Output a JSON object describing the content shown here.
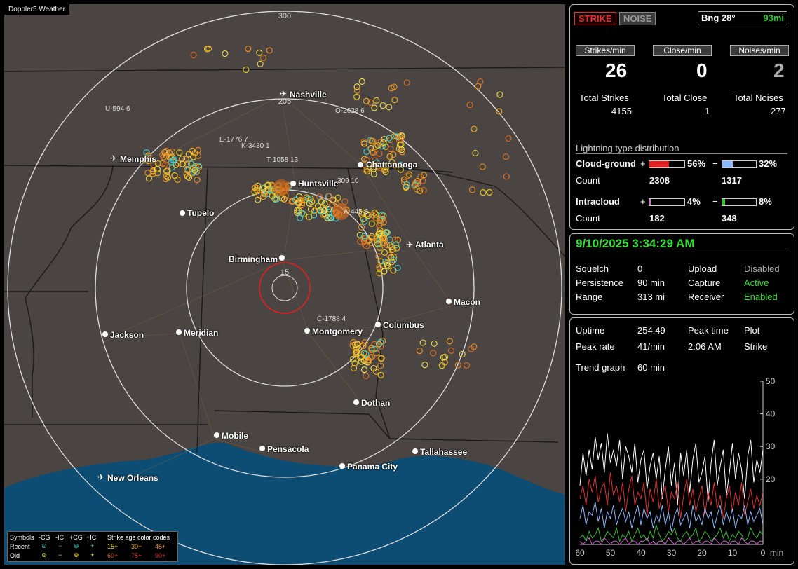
{
  "app": {
    "title": "Doppler5 Weather"
  },
  "header": {
    "strike_label": "STRIKE",
    "noise_label": "NOISE",
    "bearing": "Bng 28°",
    "distance": "93mi"
  },
  "rates": {
    "strikes_label": "Strikes/min",
    "close_label": "Close/min",
    "noises_label": "Noises/min",
    "strikes_value": "26",
    "close_value": "0",
    "noises_value": "2"
  },
  "totals": {
    "strikes_label": "Total Strikes",
    "close_label": "Total Close",
    "noises_label": "Total Noises",
    "strikes_value": "4155",
    "close_value": "1",
    "noises_value": "277"
  },
  "distribution": {
    "title": "Lightning type distribution",
    "cg_label": "Cloud-ground",
    "ic_label": "Intracloud",
    "count_label": "Count",
    "cg_pos_pct": "56%",
    "cg_neg_pct": "32%",
    "cg_pos_count": "2308",
    "cg_neg_count": "1317",
    "ic_pos_pct": "4%",
    "ic_neg_pct": "8%",
    "ic_pos_count": "182",
    "ic_neg_count": "348",
    "plus": "+",
    "minus": "−",
    "fractions": {
      "cg_pos": 0.56,
      "cg_neg": 0.32,
      "ic_pos": 0.04,
      "ic_neg": 0.08
    }
  },
  "status": {
    "datetime": "9/10/2025 3:34:29 AM",
    "squelch_label": "Squelch",
    "squelch_value": "0",
    "persistence_label": "Persistence",
    "persistence_value": "90 min",
    "range_label": "Range",
    "range_value": "313 mi",
    "upload_label": "Upload",
    "upload_value": "Disabled",
    "capture_label": "Capture",
    "capture_value": "Active",
    "receiver_label": "Receiver",
    "receiver_value": "Enabled"
  },
  "stats": {
    "uptime_label": "Uptime",
    "uptime_value": "254:49",
    "peaktime_label": "Peak time",
    "peaktime_value": "2:06 AM",
    "plot_label": "Plot",
    "plot_value": "Strike",
    "peakrate_label": "Peak rate",
    "peakrate_value": "41/min",
    "trend_label": "Trend graph",
    "trend_value": "60 min"
  },
  "chart_data": {
    "type": "line",
    "title": "",
    "xlabel": "min",
    "ylabel": "",
    "x_ticks": [
      "60",
      "50",
      "40",
      "30",
      "20",
      "10",
      "0"
    ],
    "y_ticks": [
      "50",
      "40",
      "30",
      "20"
    ],
    "xlim": [
      60,
      0
    ],
    "ylim": [
      0,
      50
    ],
    "series": [
      {
        "color": "#ffffff",
        "values": [
          18,
          28,
          21,
          29,
          23,
          33,
          26,
          31,
          22,
          34,
          25,
          29,
          24,
          32,
          20,
          30,
          27,
          22,
          31,
          19,
          26,
          29,
          17,
          24,
          28,
          20,
          27,
          14,
          23,
          30,
          18,
          25,
          12,
          28,
          21,
          29,
          16,
          26,
          31,
          19,
          22,
          27,
          13,
          25,
          32,
          18,
          24,
          29,
          15,
          22,
          31,
          20,
          28,
          23,
          14,
          27,
          32,
          19,
          26,
          22,
          29
        ]
      },
      {
        "color": "#e03030",
        "values": [
          14,
          18,
          12,
          20,
          16,
          21,
          13,
          17,
          19,
          12,
          22,
          15,
          18,
          13,
          19,
          10,
          17,
          21,
          12,
          16,
          14,
          19,
          9,
          17,
          13,
          20,
          11,
          15,
          18,
          10,
          16,
          14,
          19,
          8,
          15,
          20,
          12,
          17,
          10,
          14,
          18,
          9,
          16,
          12,
          19,
          11,
          15,
          8,
          14,
          18,
          10,
          16,
          12,
          19,
          9,
          13,
          17,
          11,
          15,
          12,
          16
        ]
      },
      {
        "color": "#8ab8ff",
        "values": [
          8,
          12,
          6,
          10,
          9,
          13,
          7,
          11,
          5,
          10,
          8,
          12,
          6,
          9,
          11,
          7,
          10,
          5,
          9,
          12,
          6,
          11,
          8,
          10,
          5,
          9,
          7,
          12,
          6,
          10,
          4,
          9,
          11,
          6,
          8,
          10,
          5,
          12,
          7,
          9,
          6,
          11,
          8,
          10,
          5,
          9,
          12,
          6,
          10,
          7,
          11,
          5,
          9,
          8,
          12,
          6,
          10,
          7,
          9,
          11,
          6
        ]
      },
      {
        "color": "#30c030",
        "values": [
          2,
          3,
          1,
          4,
          2,
          3,
          5,
          1,
          2,
          4,
          3,
          2,
          5,
          1,
          3,
          2,
          4,
          1,
          3,
          5,
          2,
          3,
          1,
          4,
          2,
          6,
          3,
          1,
          2,
          4,
          3,
          5,
          2,
          1,
          3,
          4,
          2,
          3,
          5,
          1,
          2,
          4,
          3,
          1,
          2,
          3,
          5,
          2,
          4,
          1,
          3,
          2,
          4,
          3,
          1,
          2,
          5,
          3,
          2,
          4,
          3
        ]
      },
      {
        "color": "#d060d0",
        "values": [
          1,
          0,
          1,
          2,
          0,
          1,
          1,
          0,
          2,
          1,
          0,
          1,
          1,
          0,
          1,
          2,
          0,
          1,
          1,
          0,
          1,
          1,
          2,
          0,
          1,
          0,
          1,
          1,
          0,
          2,
          1,
          0,
          1,
          1,
          0,
          1,
          2,
          0,
          1,
          1,
          0,
          1,
          1,
          0,
          2,
          1,
          0,
          1,
          1,
          0,
          1,
          1,
          0,
          2,
          1,
          0,
          1,
          1,
          0,
          1,
          1
        ]
      }
    ]
  },
  "map": {
    "cities": [
      "Nashville",
      "Memphis",
      "Chattanooga",
      "Huntsville",
      "Tupelo",
      "Atlanta",
      "Birmingham",
      "Macon",
      "Jackson",
      "Meridian",
      "Montgomery",
      "Columbus",
      "Dothan",
      "Mobile",
      "Pensacola",
      "Tallahassee",
      "Panama City",
      "New Orleans"
    ],
    "range_rings": [
      "300",
      "205",
      "15"
    ],
    "tracks": [
      "U-594 6",
      "E-1776 7",
      "K-3430 1",
      "T-1058 13",
      "O-2628 6",
      "309 10",
      "A-445 6",
      "C-1788 4"
    ]
  },
  "legend": {
    "symbols": "Symbols",
    "neg_cg": "-CG",
    "neg_ic": "-IC",
    "pos_cg": "+CG",
    "pos_ic": "+IC",
    "age_title": "Strike age color codes",
    "recent": "Recent",
    "old": "Old",
    "age_15": "15+",
    "age_30": "30+",
    "age_45": "45+",
    "age_60": "60+",
    "age_75": "75+",
    "age_90": "90+"
  }
}
